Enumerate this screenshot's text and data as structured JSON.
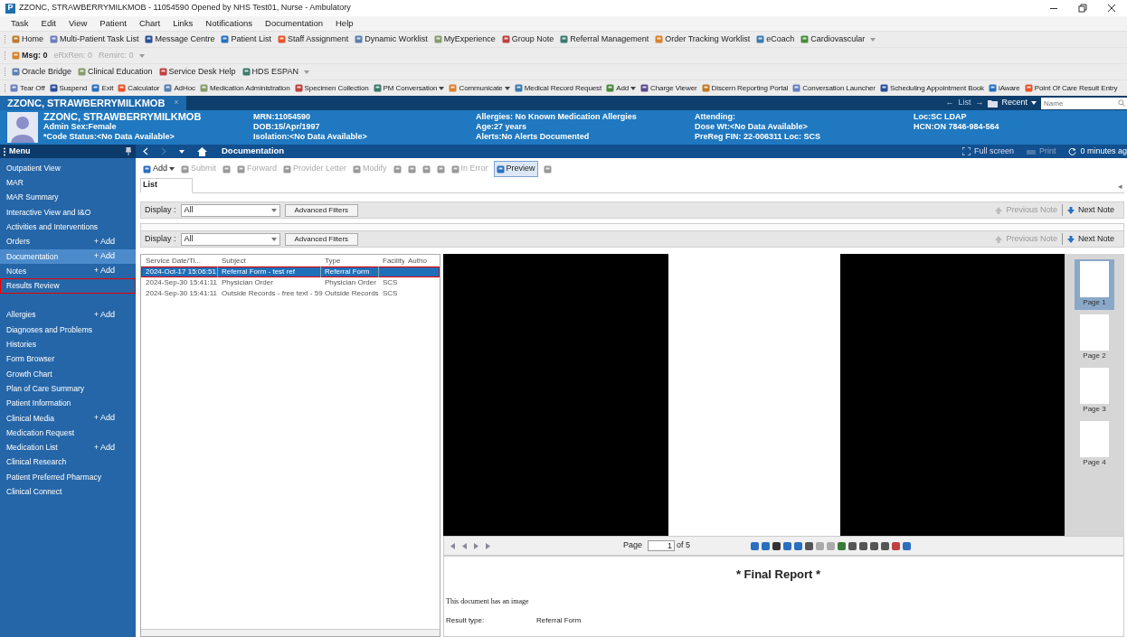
{
  "window": {
    "app_letter": "P",
    "title": "ZZONC, STRAWBERRYMILKMOB - 11054590 Opened by NHS Test01, Nurse - Ambulatory"
  },
  "menu_bar": [
    "Task",
    "Edit",
    "View",
    "Patient",
    "Chart",
    "Links",
    "Notifications",
    "Documentation",
    "Help"
  ],
  "toolbars": [
    [
      {
        "label": "Home",
        "disabled": false,
        "dropdown": false
      },
      {
        "label": "Multi-Patient Task List",
        "disabled": false,
        "dropdown": false
      },
      {
        "label": "Message Centre",
        "disabled": false,
        "dropdown": false
      },
      {
        "label": "Patient List",
        "disabled": false,
        "dropdown": false
      },
      {
        "label": "Staff Assignment",
        "disabled": false,
        "dropdown": false
      },
      {
        "label": "Dynamic Worklist",
        "disabled": false,
        "dropdown": false
      },
      {
        "label": "MyExperience",
        "disabled": false,
        "dropdown": false
      },
      {
        "label": "Group Note",
        "disabled": false,
        "dropdown": false
      },
      {
        "label": "Referral Management",
        "disabled": false,
        "dropdown": false
      },
      {
        "label": "Order Tracking Worklist",
        "disabled": false,
        "dropdown": false
      },
      {
        "label": "eCoach",
        "disabled": false,
        "dropdown": false
      },
      {
        "label": "Cardiovascular",
        "disabled": false,
        "dropdown": false
      }
    ],
    [
      {
        "label": "Msg: 0",
        "disabled": false,
        "dropdown": false
      },
      {
        "label": "eRxRen: 0",
        "disabled": true,
        "dropdown": false
      },
      {
        "label": "Remirc: 0",
        "disabled": true,
        "dropdown": false
      }
    ],
    [
      {
        "label": "Oracle Bridge",
        "disabled": false,
        "dropdown": false
      },
      {
        "label": "Clinical Education",
        "disabled": false,
        "dropdown": false
      },
      {
        "label": "Service Desk Help",
        "disabled": false,
        "dropdown": false
      },
      {
        "label": "HDS ESPAN",
        "disabled": false,
        "dropdown": false
      }
    ],
    [
      {
        "label": "Tear Off",
        "disabled": false,
        "dropdown": false
      },
      {
        "label": "Suspend",
        "disabled": false,
        "dropdown": false
      },
      {
        "label": "Exit",
        "disabled": false,
        "dropdown": false
      },
      {
        "label": "Calculator",
        "disabled": false,
        "dropdown": false
      },
      {
        "label": "AdHoc",
        "disabled": false,
        "dropdown": false
      },
      {
        "label": "Medication Administration",
        "disabled": false,
        "dropdown": false
      },
      {
        "label": "Specimen Collection",
        "disabled": false,
        "dropdown": false
      },
      {
        "label": "PM Conversation",
        "disabled": false,
        "dropdown": true
      },
      {
        "label": "Communicate",
        "disabled": false,
        "dropdown": true
      },
      {
        "label": "Medical Record Request",
        "disabled": false,
        "dropdown": false
      },
      {
        "label": "Add",
        "disabled": false,
        "dropdown": true
      },
      {
        "label": "Charge Viewer",
        "disabled": false,
        "dropdown": false
      },
      {
        "label": "Discern Reporting Portal",
        "disabled": false,
        "dropdown": false
      },
      {
        "label": "Conversation Launcher",
        "disabled": false,
        "dropdown": false
      },
      {
        "label": "Scheduling Appointment Book",
        "disabled": false,
        "dropdown": false
      },
      {
        "label": "iAware",
        "disabled": false,
        "dropdown": false
      },
      {
        "label": "Point Of Care Result Entry",
        "disabled": false,
        "dropdown": false
      }
    ]
  ],
  "patient_tab": {
    "label": "ZZONC, STRAWBERRYMILKMOB",
    "close": "×"
  },
  "banner_nav": {
    "back": "←",
    "list": "List",
    "forward": "→",
    "recent": "Recent",
    "search_placeholder": "Name"
  },
  "patient_header": [
    [
      "ZZONC, STRAWBERRYMILKMOB",
      "Admin Sex:Female",
      "*Code Status:<No Data Available>"
    ],
    [
      "MRN:11054590",
      "DOB:15/Apr/1997",
      "Isolation:<No Data Available>"
    ],
    [
      "Allergies: No Known Medication Allergies",
      "Age:27 years",
      "Alerts:No Alerts Documented"
    ],
    [
      "Attending:",
      "Dose Wt:<No Data Available>",
      "PreReg FIN: 22-006311 Loc: SCS"
    ],
    [
      "Loc:SC LDAP",
      "HCN:ON 7846-984-564"
    ]
  ],
  "nav_bar": {
    "menu": "Menu",
    "page_title": "Documentation",
    "full_screen": "Full screen",
    "print": "Print",
    "print_disabled": true,
    "refresh": "0 minutes ag"
  },
  "sidebar": [
    {
      "label": "Outpatient View",
      "selected": false,
      "highlighted": false
    },
    {
      "label": "MAR",
      "selected": false,
      "highlighted": false
    },
    {
      "label": "MAR Summary",
      "selected": false,
      "highlighted": false
    },
    {
      "label": "Interactive View and I&O",
      "selected": false,
      "highlighted": false
    },
    {
      "label": "Activities and Interventions",
      "selected": false,
      "highlighted": false
    },
    {
      "label": "Orders",
      "add": "+ Add",
      "selected": false,
      "highlighted": false
    },
    {
      "label": "Documentation",
      "add": "+ Add",
      "selected": true,
      "highlighted": false
    },
    {
      "label": "Notes",
      "add": "+ Add",
      "selected": false,
      "highlighted": false
    },
    {
      "label": "Results Review",
      "selected": false,
      "highlighted": true
    },
    {
      "label": "Allergies",
      "add": "+ Add",
      "selected": false,
      "highlighted": false,
      "gap_before": true
    },
    {
      "label": "Diagnoses and Problems",
      "selected": false,
      "highlighted": false
    },
    {
      "label": "Histories",
      "selected": false,
      "highlighted": false
    },
    {
      "label": "Form Browser",
      "selected": false,
      "highlighted": false
    },
    {
      "label": "Growth Chart",
      "selected": false,
      "highlighted": false
    },
    {
      "label": "Plan of Care Summary",
      "selected": false,
      "highlighted": false
    },
    {
      "label": "Patient Information",
      "selected": false,
      "highlighted": false
    },
    {
      "label": "Clinical Media",
      "add": "+ Add",
      "selected": false,
      "highlighted": false
    },
    {
      "label": "Medication Request",
      "selected": false,
      "highlighted": false
    },
    {
      "label": "Medication List",
      "add": "+ Add",
      "selected": false,
      "highlighted": false
    },
    {
      "label": "Clinical Research",
      "selected": false,
      "highlighted": false
    },
    {
      "label": "Patient Preferred Pharmacy",
      "selected": false,
      "highlighted": false
    },
    {
      "label": "Clinical Connect",
      "selected": false,
      "highlighted": false
    }
  ],
  "doc_toolbar": [
    {
      "kind": "text",
      "label": "Add",
      "disabled": false,
      "dropdown": true,
      "selected": false
    },
    {
      "kind": "text",
      "label": "Submit",
      "disabled": true,
      "dropdown": false,
      "selected": false
    },
    {
      "kind": "icon",
      "disabled": true,
      "selected": false
    },
    {
      "kind": "text",
      "label": "Forward",
      "disabled": true,
      "dropdown": false,
      "selected": false
    },
    {
      "kind": "text",
      "label": "Provider Letter",
      "disabled": true,
      "dropdown": false,
      "selected": false
    },
    {
      "kind": "text",
      "label": "Modify",
      "disabled": true,
      "dropdown": false,
      "selected": false
    },
    {
      "kind": "icon",
      "disabled": true,
      "selected": false
    },
    {
      "kind": "icon",
      "disabled": true,
      "selected": false
    },
    {
      "kind": "icon",
      "disabled": true,
      "selected": false
    },
    {
      "kind": "icon",
      "disabled": true,
      "selected": false
    },
    {
      "kind": "text",
      "label": "In Error",
      "disabled": true,
      "dropdown": false,
      "selected": false
    },
    {
      "kind": "text",
      "label": "Preview",
      "disabled": false,
      "dropdown": false,
      "selected": true
    },
    {
      "kind": "icon",
      "disabled": true,
      "selected": false
    }
  ],
  "tabs": [
    {
      "label": "List",
      "selected": true
    }
  ],
  "tab_scroll": "◂",
  "filter_bars": [
    {
      "display_label": "Display :",
      "display_value": "All",
      "advanced": "Advanced Filters",
      "previous": "Previous Note",
      "previous_disabled": true,
      "next": "Next Note"
    },
    {
      "display_label": "Display :",
      "display_value": "All",
      "advanced": "Advanced Filters",
      "previous": "Previous Note",
      "previous_disabled": true,
      "next": "Next Note"
    }
  ],
  "document_list": {
    "columns": [
      "Service Date/Ti...",
      "Subject",
      "Type",
      "Facility",
      "Autho"
    ],
    "rows": [
      {
        "date": "2024-Oct-17 15:06:51",
        "subject": "Referral Form - test ref",
        "type": "Referral Form",
        "selected": true,
        "highlighted": true
      },
      {
        "date": "2024-Sep-30 15:41:11",
        "subject": "Physician Order",
        "type": "Physician Order",
        "facility": "SCS",
        "selected": false,
        "highlighted": false
      },
      {
        "date": "2024-Sep-30 15:41:11",
        "subject": "Outside Records - free text - 59",
        "type": "Outside Records",
        "facility": "SCS",
        "selected": false,
        "highlighted": false
      }
    ]
  },
  "preview": {
    "pager": {
      "label": "Page",
      "value": "1",
      "total": "of 5"
    },
    "thumbnails": [
      {
        "label": "Page 1",
        "selected": true
      },
      {
        "label": "Page 2",
        "selected": false
      },
      {
        "label": "Page 3",
        "selected": false
      },
      {
        "label": "Page 4",
        "selected": false
      }
    ],
    "report": {
      "title": "* Final Report *",
      "note": "This document has an image",
      "fields": [
        {
          "label": "Result type:",
          "value": "Referral Form"
        }
      ]
    }
  }
}
